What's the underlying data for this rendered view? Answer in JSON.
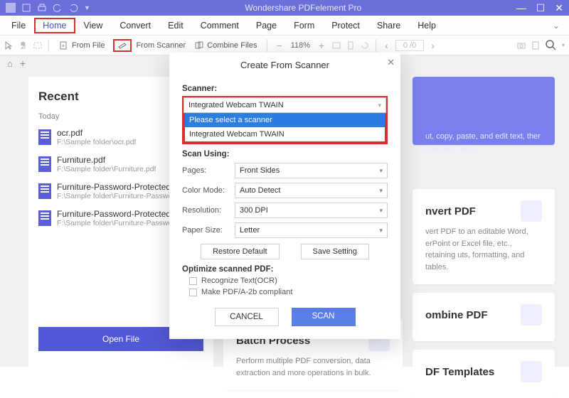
{
  "titlebar": {
    "title": "Wondershare PDFelement Pro"
  },
  "menu": {
    "items": [
      "File",
      "Home",
      "View",
      "Convert",
      "Edit",
      "Comment",
      "Page",
      "Form",
      "Protect",
      "Share",
      "Help"
    ],
    "active": "Home"
  },
  "toolbar": {
    "from_file": "From File",
    "from_scanner": "From Scanner",
    "combine_files": "Combine Files",
    "zoom": "118%",
    "page_ind": "0 /0"
  },
  "recent": {
    "heading": "Recent",
    "group": "Today",
    "files": [
      {
        "name": "ocr.pdf",
        "path": "F:\\Sample folder\\ocr.pdf"
      },
      {
        "name": "Furniture.pdf",
        "path": "F:\\Sample folder\\Furniture.pdf"
      },
      {
        "name": "Furniture-Password-Protected-Co",
        "path": "F:\\Sample folder\\Furniture-Password"
      },
      {
        "name": "Furniture-Password-Protected.pd",
        "path": "F:\\Sample folder\\Furniture-Password"
      }
    ],
    "open_btn": "Open File"
  },
  "cards": {
    "edit_desc": "ut, copy, paste, and edit text, ther objects in PDF.",
    "convert_h": "nvert PDF",
    "convert_p": "vert PDF to an editable Word, erPoint or Excel file, etc., retaining uts, formatting, and tables.",
    "combine_h": "ombine PDF",
    "templates_h": "DF Templates",
    "batch_h": "Batch Process",
    "batch_p": "Perform multiple PDF conversion, data extraction and more operations in bulk."
  },
  "dialog": {
    "title": "Create From Scanner",
    "scanner_label": "Scanner:",
    "scanner_value": "Integrated Webcam TWAIN",
    "scanner_options": [
      "Please select a scanner",
      "Integrated Webcam TWAIN"
    ],
    "scan_using": "Scan Using:",
    "fields": {
      "pages_l": "Pages:",
      "pages_v": "Front Sides",
      "color_l": "Color Mode:",
      "color_v": "Auto Detect",
      "res_l": "Resolution:",
      "res_v": "300 DPI",
      "paper_l": "Paper Size:",
      "paper_v": "Letter"
    },
    "restore": "Restore Default",
    "save": "Save Setting",
    "optimize_l": "Optimize scanned PDF:",
    "ocr": "Recognize Text(OCR)",
    "pdfa": "Make PDF/A-2b compliant",
    "cancel": "CANCEL",
    "scan": "SCAN"
  }
}
